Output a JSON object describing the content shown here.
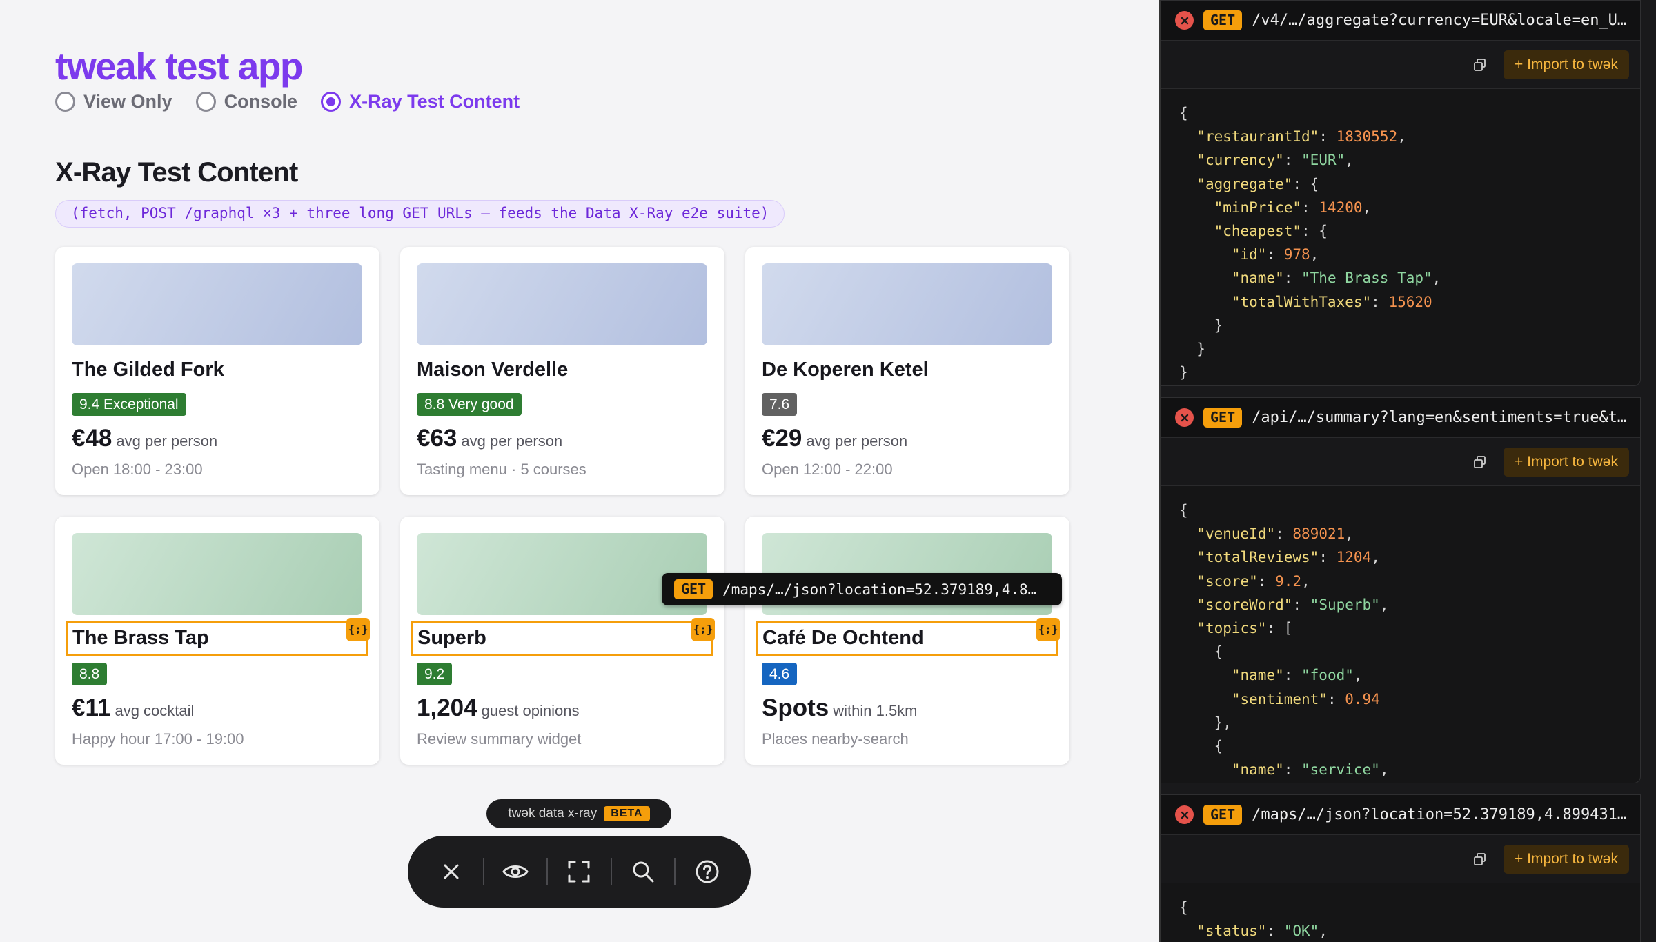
{
  "app": {
    "title": "tweak test app",
    "modes": [
      "View Only",
      "Console",
      "X-Ray Test Content"
    ],
    "active_mode": "X-Ray Test Content",
    "section_title": "X-Ray Test Content",
    "section_subtitle": "(fetch, POST /graphql ×3 + three long GET URLs — feeds the Data X-Ray e2e suite)"
  },
  "cards": [
    {
      "name": "The Gilded Fork",
      "badge": "9.4 Exceptional",
      "price": "€48",
      "price_unit": "avg per person",
      "meta": "Open 18:00 - 23:00"
    },
    {
      "name": "Maison Verdelle",
      "badge": "8.8 Very good",
      "price": "€63",
      "price_unit": "avg per person",
      "meta": "Tasting menu · 5 courses"
    },
    {
      "name": "De Koperen Ketel",
      "badge": "7.6",
      "price": "€29",
      "price_unit": "avg per person",
      "meta": "Open 12:00 - 22:00"
    },
    {
      "name": "The Brass Tap",
      "badge": "8.8",
      "price": "€11",
      "price_unit": "avg cocktail",
      "meta": "Happy hour 17:00 - 19:00"
    },
    {
      "name": "Superb",
      "badge": "9.2",
      "price": "1,204",
      "price_unit": "guest opinions",
      "meta": "Review summary widget"
    },
    {
      "name": "Café De Ochtend",
      "badge": "4.6",
      "price": "Spots",
      "price_unit": "within 1.5km",
      "meta": "Places nearby-search"
    }
  ],
  "xray_badge": "{;}",
  "hover_tooltip": {
    "method": "GET",
    "url": "/maps/…/json?location=52.379189,4.8…"
  },
  "toolbar": {
    "label": "twək data x-ray",
    "beta": "BETA"
  },
  "colors": {
    "accent": "#7c3aed",
    "xray": "#f59e0b",
    "badge_green": "#2e7d32",
    "badge_gray": "#616161",
    "badge_blue": "#1565c0"
  },
  "icons": [
    "close-icon",
    "eye-icon",
    "frame-icon",
    "search-icon",
    "help-icon",
    "copy-icon"
  ],
  "requests": [
    {
      "method": "GET",
      "url": "/v4/…/aggregate?currency=EUR&locale=en_U…",
      "copy_label": "⧉",
      "import_label": "+ Import to twək",
      "json": [
        [
          [
            "p",
            "{"
          ]
        ],
        [
          [
            "p",
            "  "
          ],
          [
            "k",
            "\"restaurantId\""
          ],
          [
            "p",
            ": "
          ],
          [
            "n",
            "1830552"
          ],
          [
            "p",
            ","
          ]
        ],
        [
          [
            "p",
            "  "
          ],
          [
            "k",
            "\"currency\""
          ],
          [
            "p",
            ": "
          ],
          [
            "s",
            "\"EUR\""
          ],
          [
            "p",
            ","
          ]
        ],
        [
          [
            "p",
            "  "
          ],
          [
            "k",
            "\"aggregate\""
          ],
          [
            "p",
            ": {"
          ]
        ],
        [
          [
            "p",
            "    "
          ],
          [
            "k",
            "\"minPrice\""
          ],
          [
            "p",
            ": "
          ],
          [
            "n",
            "14200"
          ],
          [
            "p",
            ","
          ]
        ],
        [
          [
            "p",
            "    "
          ],
          [
            "k",
            "\"cheapest\""
          ],
          [
            "p",
            ": {"
          ]
        ],
        [
          [
            "p",
            "      "
          ],
          [
            "k",
            "\"id\""
          ],
          [
            "p",
            ": "
          ],
          [
            "n",
            "978"
          ],
          [
            "p",
            ","
          ]
        ],
        [
          [
            "p",
            "      "
          ],
          [
            "k",
            "\"name\""
          ],
          [
            "p",
            ": "
          ],
          [
            "s",
            "\"The Brass Tap\""
          ],
          [
            "p",
            ","
          ]
        ],
        [
          [
            "p",
            "      "
          ],
          [
            "k",
            "\"totalWithTaxes\""
          ],
          [
            "p",
            ": "
          ],
          [
            "n",
            "15620"
          ]
        ],
        [
          [
            "p",
            "    }"
          ]
        ],
        [
          [
            "p",
            "  }"
          ]
        ],
        [
          [
            "p",
            "}"
          ]
        ]
      ]
    },
    {
      "method": "GET",
      "url": "/api/…/summary?lang=en&sentiments=true&t…",
      "copy_label": "⧉",
      "import_label": "+ Import to twək",
      "json": [
        [
          [
            "p",
            "{"
          ]
        ],
        [
          [
            "p",
            "  "
          ],
          [
            "k",
            "\"venueId\""
          ],
          [
            "p",
            ": "
          ],
          [
            "n",
            "889021"
          ],
          [
            "p",
            ","
          ]
        ],
        [
          [
            "p",
            "  "
          ],
          [
            "k",
            "\"totalReviews\""
          ],
          [
            "p",
            ": "
          ],
          [
            "n",
            "1204"
          ],
          [
            "p",
            ","
          ]
        ],
        [
          [
            "p",
            "  "
          ],
          [
            "k",
            "\"score\""
          ],
          [
            "p",
            ": "
          ],
          [
            "n",
            "9.2"
          ],
          [
            "p",
            ","
          ]
        ],
        [
          [
            "p",
            "  "
          ],
          [
            "k",
            "\"scoreWord\""
          ],
          [
            "p",
            ": "
          ],
          [
            "s",
            "\"Superb\""
          ],
          [
            "p",
            ","
          ]
        ],
        [
          [
            "p",
            "  "
          ],
          [
            "k",
            "\"topics\""
          ],
          [
            "p",
            ": ["
          ]
        ],
        [
          [
            "p",
            "    {"
          ]
        ],
        [
          [
            "p",
            "      "
          ],
          [
            "k",
            "\"name\""
          ],
          [
            "p",
            ": "
          ],
          [
            "s",
            "\"food\""
          ],
          [
            "p",
            ","
          ]
        ],
        [
          [
            "p",
            "      "
          ],
          [
            "k",
            "\"sentiment\""
          ],
          [
            "p",
            ": "
          ],
          [
            "n",
            "0.94"
          ]
        ],
        [
          [
            "p",
            "    },"
          ]
        ],
        [
          [
            "p",
            "    {"
          ]
        ],
        [
          [
            "p",
            "      "
          ],
          [
            "k",
            "\"name\""
          ],
          [
            "p",
            ": "
          ],
          [
            "s",
            "\"service\""
          ],
          [
            "p",
            ","
          ]
        ]
      ]
    },
    {
      "method": "GET",
      "url": "/maps/…/json?location=52.379189,4.899431…",
      "copy_label": "⧉",
      "import_label": "+ Import to twək",
      "json": [
        [
          [
            "p",
            "{"
          ]
        ],
        [
          [
            "p",
            "  "
          ],
          [
            "k",
            "\"status\""
          ],
          [
            "p",
            ": "
          ],
          [
            "s",
            "\"OK\""
          ],
          [
            "p",
            ","
          ]
        ]
      ]
    }
  ]
}
